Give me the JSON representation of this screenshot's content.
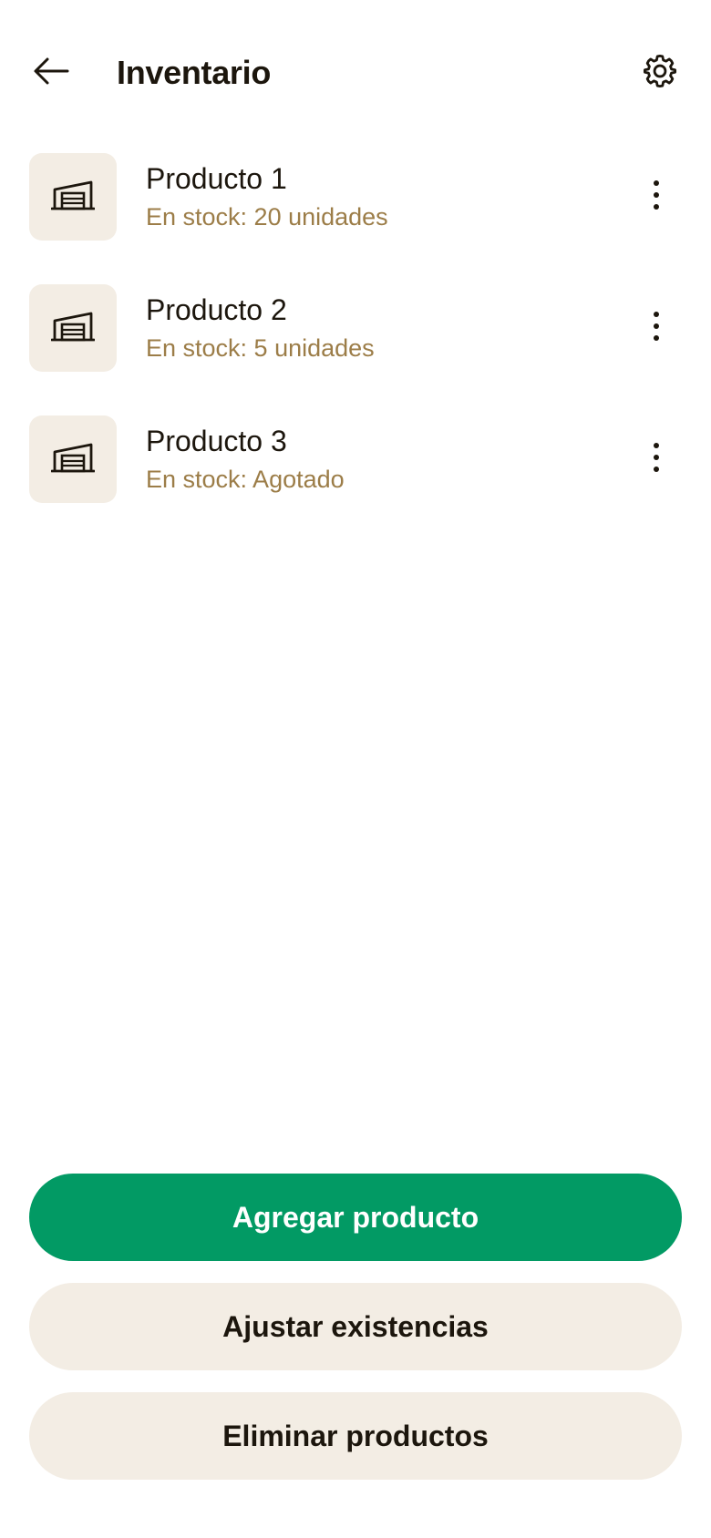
{
  "header": {
    "title": "Inventario",
    "back_icon": "arrow-left-icon",
    "settings_icon": "gear-icon"
  },
  "products": [
    {
      "name": "Producto 1",
      "stock": "En stock: 20 unidades",
      "icon": "warehouse-icon"
    },
    {
      "name": "Producto 2",
      "stock": "En stock: 5 unidades",
      "icon": "warehouse-icon"
    },
    {
      "name": "Producto 3",
      "stock": "En stock: Agotado",
      "icon": "warehouse-icon"
    }
  ],
  "actions": {
    "add_label": "Agregar producto",
    "adjust_label": "Ajustar existencias",
    "delete_label": "Eliminar productos"
  },
  "colors": {
    "primary": "#029a64",
    "secondary_bg": "#f3ede4",
    "stock_text": "#9c7d48",
    "text": "#1c160d"
  }
}
